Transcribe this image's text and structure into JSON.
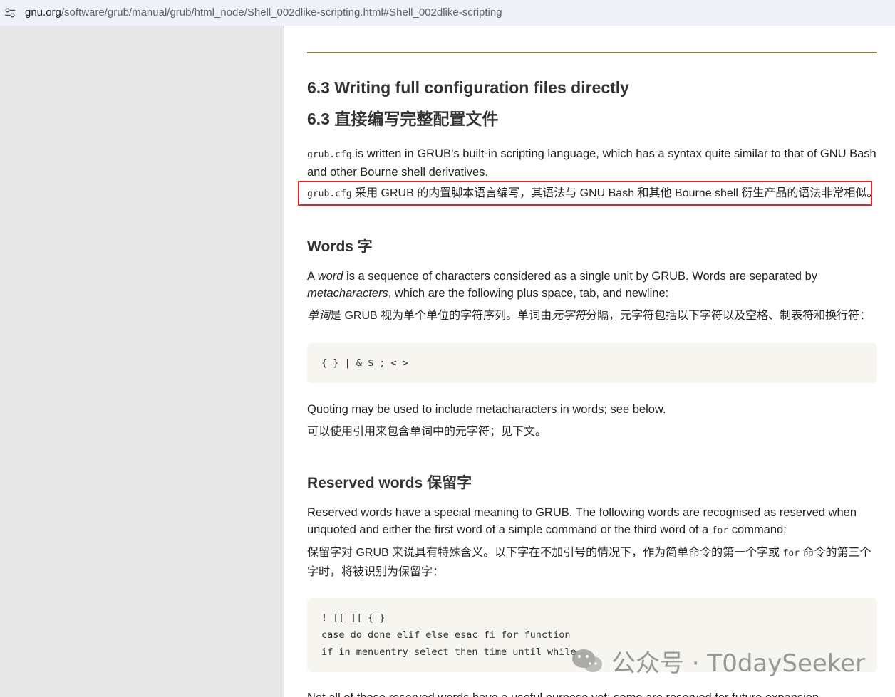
{
  "browser": {
    "url_domain": "gnu.org",
    "url_path": "/software/grub/manual/grub/html_node/Shell_002dlike-scripting.html#Shell_002dlike-scripting"
  },
  "section": {
    "heading_en": "6.3 Writing full configuration files directly",
    "heading_zh": "6.3 直接编写完整配置文件",
    "intro_code": "grub.cfg",
    "intro_en": " is written in GRUB’s built-in scripting language, which has a syntax quite similar to that of GNU Bash and other Bourne shell derivatives.",
    "intro_zh_code": "grub.cfg",
    "intro_zh": " 采用 GRUB 的内置脚本语言编写，其语法与 GNU Bash 和其他 Bourne shell 衍生产品的语法非常相似。"
  },
  "words": {
    "heading": "Words  字",
    "p1_a": "A ",
    "p1_word": "word",
    "p1_b": " is a sequence of characters considered as a single unit by GRUB. Words are separated by ",
    "p1_meta": "metacharacters",
    "p1_c": ", which are the following plus space, tab, and newline:",
    "zh_a": "单词",
    "zh_b": "是 GRUB 视为单个单位的字符序列。单词由",
    "zh_meta": "元字符",
    "zh_c": "分隔，元字符包括以下字符以及空格、制表符和换行符：",
    "code": "{ } | & $ ; < >",
    "quote_en": "Quoting may be used to include metacharacters in words; see below.",
    "quote_zh": "可以使用引用来包含单词中的元字符；见下文。"
  },
  "reserved": {
    "heading": "Reserved words  保留字",
    "en_a": "Reserved words have a special meaning to GRUB. The following words are recognised as reserved when unquoted and either the first word of a simple command or the third word of a ",
    "en_code": "for",
    "en_b": " command:",
    "zh_a": "保留字对 GRUB 来说具有特殊含义。以下字在不加引号的情况下，作为简单命令的第一个字或 ",
    "zh_code": "for",
    "zh_b": " 命令的第三个字时，将被识别为保留字：",
    "code_lines": [
      "! [[ ]] { }",
      "case do done elif else esac fi for function",
      "if in menuentry select then time until while"
    ],
    "cut_text": "Not all of these reserved words have a useful purpose yet; some are reserved for future expansion."
  },
  "watermark": {
    "text": "公众号 · T0daySeeker"
  }
}
